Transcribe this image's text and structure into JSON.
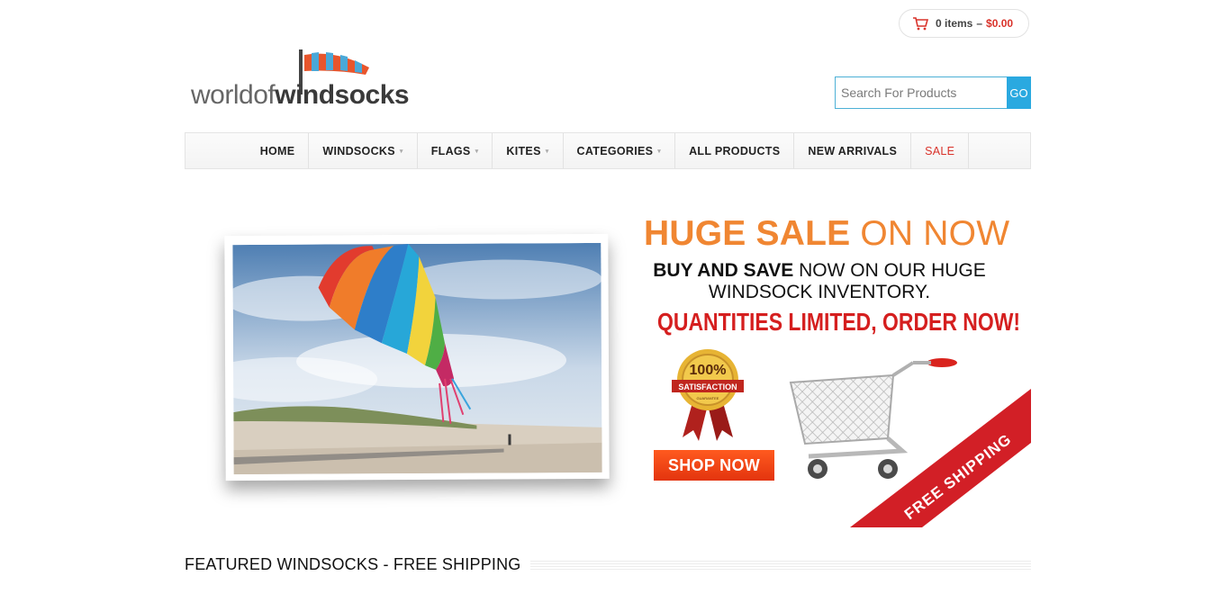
{
  "header": {
    "cart": {
      "items_text": "0 items",
      "separator": "–",
      "total": "$0.00",
      "icon": "shopping-cart-icon",
      "accent_color": "#d9322a"
    },
    "logo": {
      "part1": "worldof",
      "part2": "windsocks"
    },
    "search": {
      "placeholder": "Search For Products",
      "button_label": "GO",
      "button_color": "#2aa9e0"
    }
  },
  "nav": {
    "items": [
      {
        "label": "HOME"
      },
      {
        "label": "WINDSOCKS",
        "has_dropdown": true
      },
      {
        "label": "FLAGS",
        "has_dropdown": true
      },
      {
        "label": "KITES",
        "has_dropdown": true
      },
      {
        "label": "CATEGORIES",
        "has_dropdown": true
      },
      {
        "label": "ALL PRODUCTS"
      },
      {
        "label": "NEW ARRIVALS"
      },
      {
        "label": "SALE",
        "highlight": true
      }
    ],
    "caret": "▾"
  },
  "banner": {
    "title_bold": "HUGE SALE",
    "title_light": "ON NOW",
    "line1_bold": "BUY AND SAVE",
    "line1_rest": "NOW ON OUR HUGE",
    "line2": "WINDSOCK INVENTORY.",
    "limited": "QUANTITIES LIMITED, ORDER NOW!",
    "seal_percent": "100%",
    "seal_ribbon": "SATISFACTION",
    "seal_sub": "GUARANTEE",
    "shop_button": "SHOP NOW",
    "ribbon_text": "FREE SHIPPING",
    "colors": {
      "orange": "#f08632",
      "red": "#d51f1f"
    }
  },
  "featured": {
    "title": "FEATURED WINDSOCKS - FREE SHIPPING"
  }
}
